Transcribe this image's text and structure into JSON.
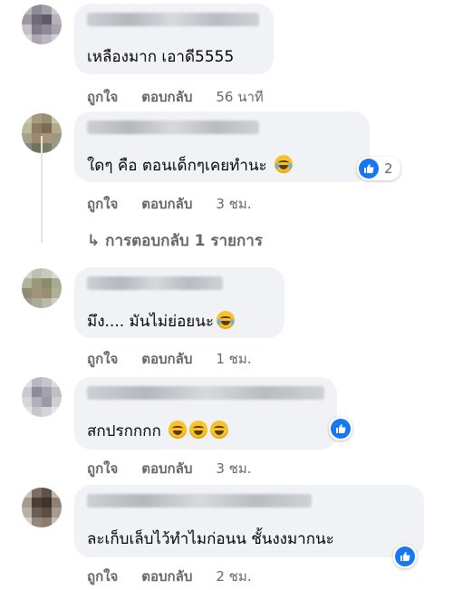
{
  "comments": [
    {
      "text": "เหลืองมาก เอาดี5555",
      "actions": {
        "like": "ถูกใจ",
        "reply": "ตอบกลับ",
        "time": "56 นาที"
      }
    },
    {
      "text": "ใดๆ คือ ตอนเด็กๆเคยทำนะ",
      "reaction_count": "2",
      "actions": {
        "like": "ถูกใจ",
        "reply": "ตอบกลับ",
        "time": "3 ชม."
      },
      "replies_link": "↳ การตอบกลับ 1 รายการ"
    },
    {
      "text": "มึง.... มันไม่ย่อยนะ",
      "actions": {
        "like": "ถูกใจ",
        "reply": "ตอบกลับ",
        "time": "1 ชม."
      }
    },
    {
      "text": "สกปรกกกก",
      "actions": {
        "like": "ถูกใจ",
        "reply": "ตอบกลับ",
        "time": "3 ชม."
      }
    },
    {
      "text": "ละเก็บเล็บไว้ทำไมก่อนน ชั้นงงมากนะ",
      "actions": {
        "like": "ถูกใจ",
        "reply": "ตอบกลับ",
        "time": "2 ชม."
      }
    }
  ],
  "colors": {
    "bubble": "#f0f2f5",
    "meta": "#65676b",
    "like_blue": "#1877f2"
  },
  "icons": [
    "like-icon",
    "laughing-emoji",
    "squinting-emoji"
  ]
}
